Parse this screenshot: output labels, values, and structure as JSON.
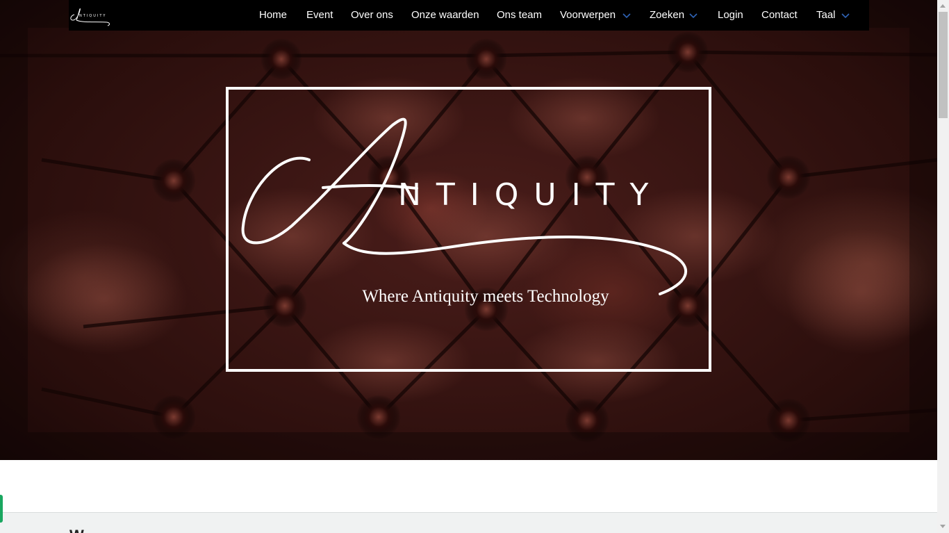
{
  "nav": {
    "items": [
      {
        "label": "Home",
        "dropdown": false
      },
      {
        "label": "Event",
        "dropdown": false
      },
      {
        "label": "Over ons",
        "dropdown": false
      },
      {
        "label": "Onze waarden",
        "dropdown": false
      },
      {
        "label": "Ons team",
        "dropdown": false
      },
      {
        "label": "Voorwerpen",
        "dropdown": true
      },
      {
        "label": "Zoeken",
        "dropdown": true
      },
      {
        "label": "Login",
        "dropdown": false
      },
      {
        "label": "Contact",
        "dropdown": false
      },
      {
        "label": "Taal",
        "dropdown": true
      }
    ],
    "chevron_icon": "chevron-down-icon",
    "chevron_color": "#2f63b5"
  },
  "brand": {
    "logo_text": "ANTIQUITY",
    "logo_icon": "antiquity-logo"
  },
  "hero": {
    "logo_word": "NTIQUITY",
    "logo_initial": "A",
    "tagline": "Where Antiquity meets Technology",
    "background": "leather-tufted-image",
    "frame_color": "#ffffff"
  },
  "section": {
    "heading": "W"
  },
  "colors": {
    "navbar": "#000000",
    "accent_green": "#1aa760",
    "section_bg": "#f0f2f2"
  }
}
